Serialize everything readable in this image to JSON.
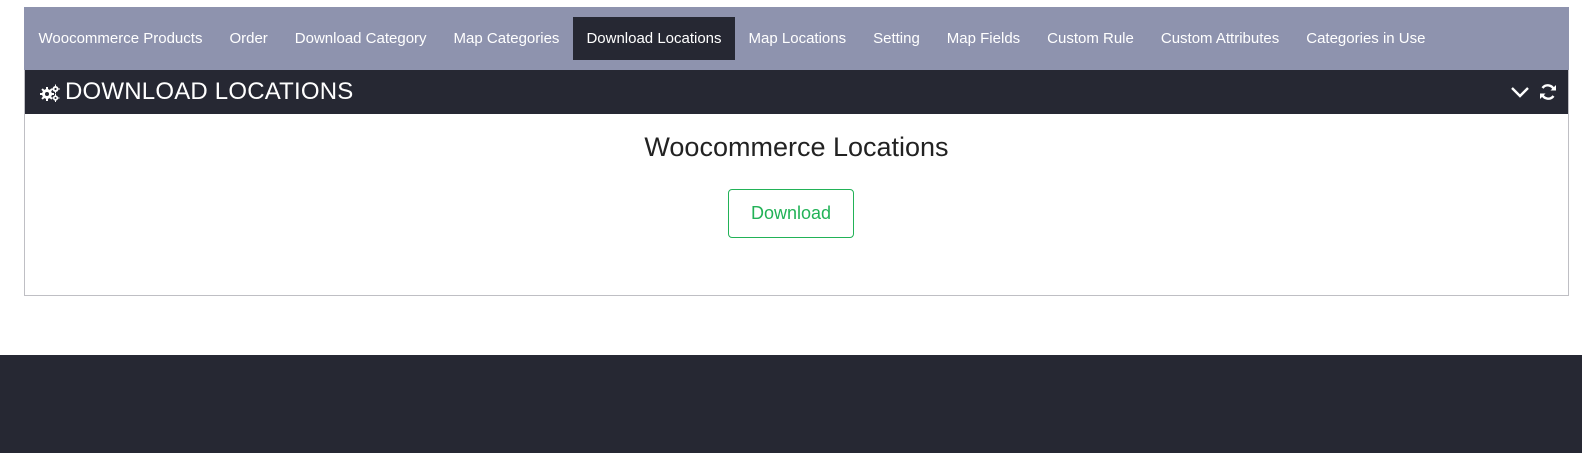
{
  "tabs": [
    {
      "label": "Woocommerce Products"
    },
    {
      "label": "Order"
    },
    {
      "label": "Download Category"
    },
    {
      "label": "Map Categories"
    },
    {
      "label": "Download Locations",
      "active": true
    },
    {
      "label": "Map Locations"
    },
    {
      "label": "Setting"
    },
    {
      "label": "Map Fields"
    },
    {
      "label": "Custom Rule"
    },
    {
      "label": "Custom Attributes"
    },
    {
      "label": "Categories in Use"
    }
  ],
  "panel": {
    "title": "DOWNLOAD LOCATIONS",
    "icons": {
      "title": "gears-icon",
      "collapse": "chevron-down-icon",
      "refresh": "refresh-icon"
    }
  },
  "content": {
    "heading": "Woocommerce Locations",
    "download_label": "Download"
  },
  "colors": {
    "tabbar": "#8e93ae",
    "dark": "#262833",
    "accent_green": "#22b257"
  }
}
